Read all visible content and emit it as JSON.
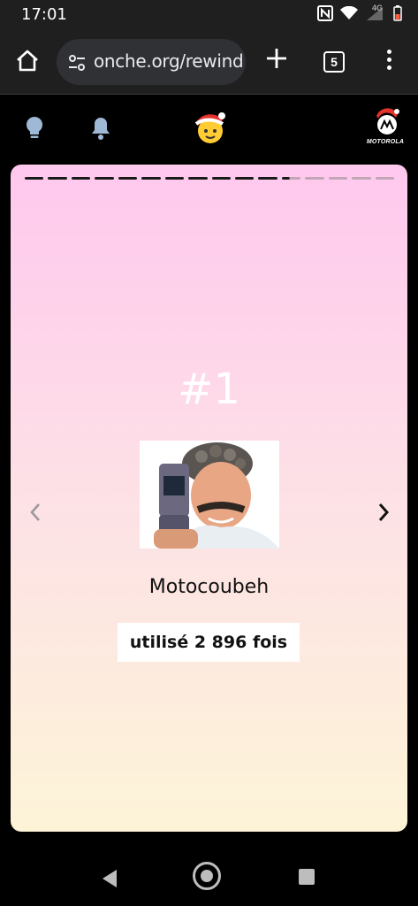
{
  "status_bar": {
    "time": "17:01",
    "network_label": "4G"
  },
  "browser": {
    "url": "onche.org/rewind",
    "tab_count": "5"
  },
  "header": {
    "brand_logo_text": "MOTOROLA"
  },
  "story": {
    "segments_total": 16,
    "segments_complete": 11,
    "rank": "#1",
    "sticker_name": "Motocoubeh",
    "usage_text": "utilisé 2 896 fois"
  },
  "icons": {
    "home": "home-icon",
    "url_settings": "tune-icon",
    "new_tab": "plus-icon",
    "menu": "more-vert-icon",
    "bulb": "lightbulb-icon",
    "bell": "bell-icon",
    "mascot": "mascot-santa-icon",
    "prev": "chevron-left-icon",
    "next": "chevron-right-icon"
  },
  "colors": {
    "card_top": "#ffc8ee",
    "card_bottom": "#fdf4d8",
    "app_bg": "#000000",
    "icon_blue": "#9fb8d6"
  }
}
